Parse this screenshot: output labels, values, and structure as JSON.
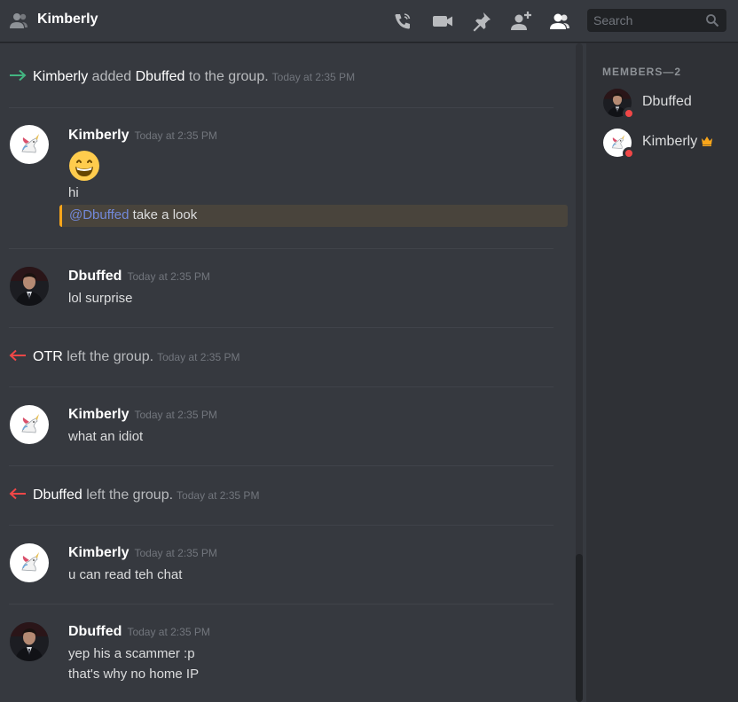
{
  "header": {
    "title": "Kimberly",
    "search_placeholder": "Search",
    "icons": [
      "dm-user-icon",
      "start-voice-call-icon",
      "start-video-call-icon",
      "pinned-messages-icon",
      "add-friends-to-dm-icon",
      "member-list-icon",
      "search-icon"
    ]
  },
  "messages": {
    "sys1": {
      "actor": "Kimberly",
      "mid": " added ",
      "target": "Dbuffed",
      "rest": " to the group.",
      "time": "Today at 2:35 PM"
    },
    "m1": {
      "author": "Kimberly",
      "time": "Today at 2:35 PM",
      "emoji": "grinning-face-emoji",
      "line1": "hi",
      "mention": "@Dbuffed",
      "mention_rest": " take a look"
    },
    "m2": {
      "author": "Dbuffed",
      "time": "Today at 2:35 PM",
      "line1": "lol surprise"
    },
    "sys2": {
      "actor": "OTR",
      "rest": " left the group.",
      "time": "Today at 2:35 PM"
    },
    "m3": {
      "author": "Kimberly",
      "time": "Today at 2:35 PM",
      "line1": "what an idiot"
    },
    "sys3": {
      "actor": "Dbuffed",
      "rest": " left the group.",
      "time": "Today at 2:35 PM"
    },
    "m4": {
      "author": "Kimberly",
      "time": "Today at 2:35 PM",
      "line1": "u can read teh chat"
    },
    "m5": {
      "author": "Dbuffed",
      "time": "Today at 2:35 PM",
      "line1": "yep his a scammer :p",
      "line2": "that's why no home IP"
    }
  },
  "members": {
    "heading": "MEMBERS—2",
    "list": [
      {
        "name": "Dbuffed",
        "status": "dnd"
      },
      {
        "name": "Kimberly",
        "status": "dnd",
        "owner": true
      }
    ]
  },
  "colors": {
    "background": "#36393f",
    "sidebar": "#2f3136",
    "join_arrow": "#43b581",
    "leave_arrow": "#f04747",
    "mention": "#7289da",
    "mention_highlight": "#faa61a",
    "dnd_status": "#f04747",
    "owner_crown": "#faa61a"
  }
}
